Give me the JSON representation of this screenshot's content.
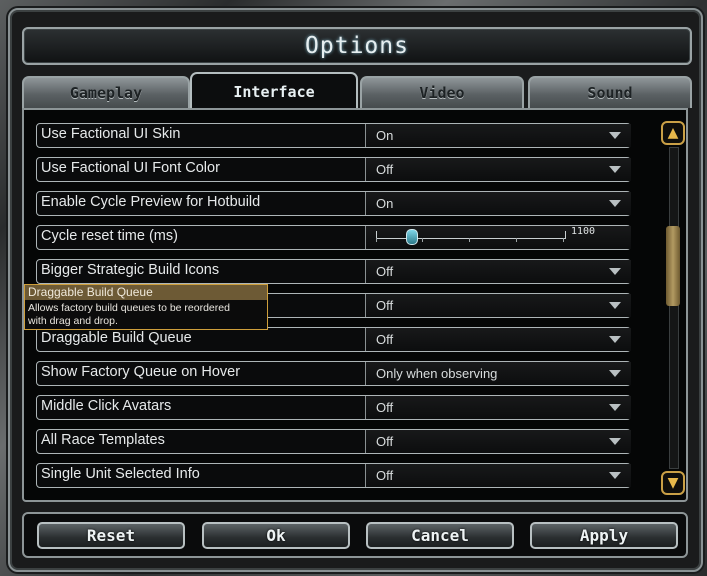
{
  "window": {
    "title": "Options"
  },
  "tabs": [
    {
      "label": "Gameplay",
      "active": false
    },
    {
      "label": "Interface",
      "active": true
    },
    {
      "label": "Video",
      "active": false
    },
    {
      "label": "Sound",
      "active": false
    }
  ],
  "settings": [
    {
      "label": "Use Factional UI Skin",
      "type": "dropdown",
      "value": "On"
    },
    {
      "label": "Use Factional UI Font Color",
      "type": "dropdown",
      "value": "Off"
    },
    {
      "label": "Enable Cycle Preview for Hotbuild",
      "type": "dropdown",
      "value": "On"
    },
    {
      "label": "Cycle reset time (ms)",
      "type": "slider",
      "value": "1100"
    },
    {
      "label": "Bigger Strategic Build Icons",
      "type": "dropdown",
      "value": "Off"
    },
    {
      "label": "",
      "type": "dropdown",
      "value": "Off"
    },
    {
      "label": "Draggable Build Queue",
      "type": "dropdown",
      "value": "Off"
    },
    {
      "label": "Show Factory Queue on Hover",
      "type": "dropdown",
      "value": "Only when observing"
    },
    {
      "label": "Middle Click Avatars",
      "type": "dropdown",
      "value": "Off"
    },
    {
      "label": "All Race Templates",
      "type": "dropdown",
      "value": "Off"
    },
    {
      "label": "Single Unit Selected Info",
      "type": "dropdown",
      "value": "Off"
    }
  ],
  "tooltip": {
    "title": "Draggable Build Queue",
    "body_line1": "Allows factory build queues to be reordered",
    "body_line2": "with drag and drop."
  },
  "scrollbar": {
    "position": 0.33
  },
  "buttons": {
    "reset": "Reset",
    "ok": "Ok",
    "cancel": "Cancel",
    "apply": "Apply"
  },
  "colors": {
    "accent_gold": "#caa046",
    "tooltip_header": "#6d5a35",
    "frame_silver": "#9aa3a5"
  }
}
